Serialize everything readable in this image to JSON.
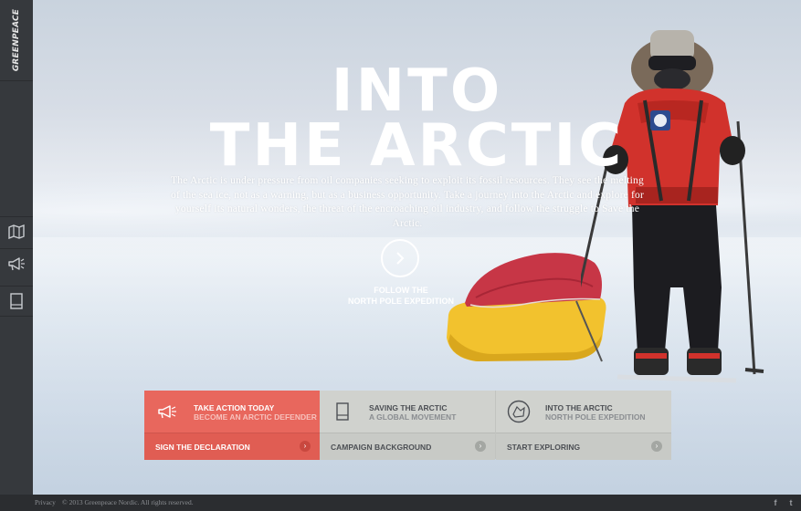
{
  "brand": {
    "logo_text": "GREENPEACE"
  },
  "sidebar": {
    "items": [
      {
        "icon": "map-icon"
      },
      {
        "icon": "megaphone-icon"
      },
      {
        "icon": "book-icon"
      }
    ]
  },
  "hero": {
    "title_line1": "INTO",
    "title_line2": "THE ARCTIC",
    "intro": "The Arctic is under pressure from oil companies seeking to exploit its fossil resources. They see the melting of the sea ice, not as a warning, but as a business opportunity. Take a journey into the Arctic and explore for yourself its natural wonders, the threat of the encroaching oil industry, and follow the struggle to Save the Arctic.",
    "cta_line1": "FOLLOW THE",
    "cta_line2": "NORTH POLE EXPEDITION"
  },
  "cards": [
    {
      "heading": "TAKE ACTION TODAY",
      "subheading": "BECOME AN ARCTIC DEFENDER",
      "action": "SIGN THE DECLARATION",
      "icon": "megaphone-icon",
      "accent": "#e8675d"
    },
    {
      "heading": "SAVING THE ARCTIC",
      "subheading": "A GLOBAL MOVEMENT",
      "action": "CAMPAIGN BACKGROUND",
      "icon": "book-icon"
    },
    {
      "heading": "INTO THE ARCTIC",
      "subheading": "NORTH POLE EXPEDITION",
      "action": "START EXPLORING",
      "icon": "map-pin-icon"
    }
  ],
  "footer": {
    "privacy": "Privacy",
    "copyright": "© 2013 Greenpeace Nordic. All rights reserved.",
    "social": [
      "facebook-icon",
      "twitter-icon"
    ],
    "facebook_glyph": "f",
    "twitter_glyph": "t"
  },
  "colors": {
    "accent": "#e8675d",
    "sidebar": "#36393d",
    "card": "#d0d2ce"
  }
}
